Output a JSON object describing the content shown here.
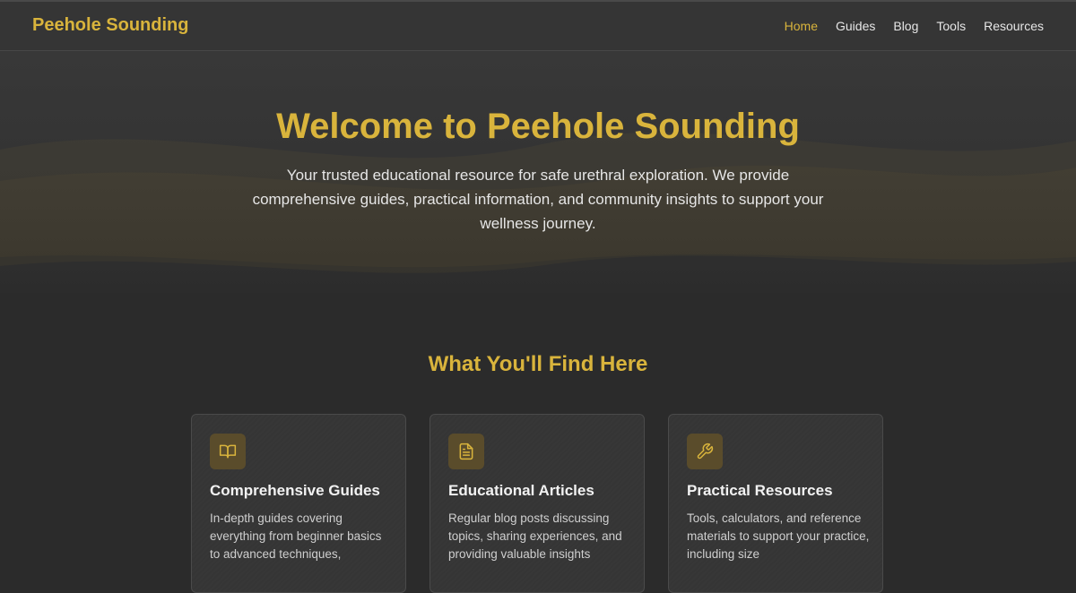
{
  "nav": {
    "brand": "Peehole Sounding",
    "links": [
      {
        "label": "Home",
        "active": true
      },
      {
        "label": "Guides",
        "active": false
      },
      {
        "label": "Blog",
        "active": false
      },
      {
        "label": "Tools",
        "active": false
      },
      {
        "label": "Resources",
        "active": false
      }
    ]
  },
  "hero": {
    "title": "Welcome to Peehole Sounding",
    "subtitle": "Your trusted educational resource for safe urethral exploration. We provide comprehensive guides, practical information, and community insights to support your wellness journey."
  },
  "features": {
    "title": "What You'll Find Here",
    "cards": [
      {
        "icon": "book-icon",
        "title": "Comprehensive Guides",
        "text": "In-depth guides covering everything from beginner basics to advanced techniques,"
      },
      {
        "icon": "document-icon",
        "title": "Educational Articles",
        "text": "Regular blog posts discussing topics, sharing experiences, and providing valuable insights"
      },
      {
        "icon": "wrench-icon",
        "title": "Practical Resources",
        "text": "Tools, calculators, and reference materials to support your practice, including size"
      }
    ]
  },
  "colors": {
    "accent": "#d9b43c",
    "background": "#2b2b2b",
    "navbar": "#353535",
    "card": "#353535",
    "icon_bg": "#5a4c2b"
  }
}
